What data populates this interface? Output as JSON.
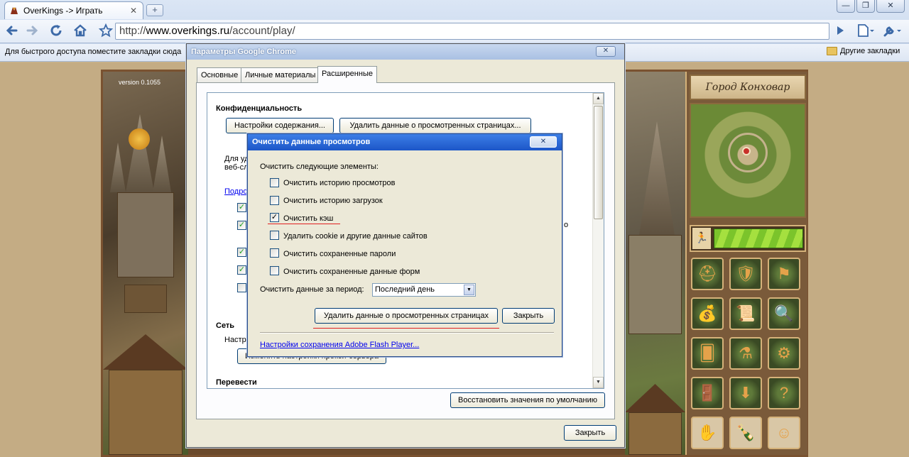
{
  "browser": {
    "tab_title": "OverKings -> Играть",
    "url_scheme": "http://",
    "url_host": "www.overkings.ru",
    "url_path": "/account/play/",
    "bookmarks_hint": "Для быстрого доступа поместите закладки сюда",
    "other_bookmarks": "Другие закладки",
    "window_controls": {
      "minimize": "—",
      "maximize": "❐",
      "close": "✕"
    }
  },
  "game": {
    "version": "version 0.1055",
    "city_name": "Город Конховар",
    "colors": {
      "energy": "#8fd234",
      "frame": "#7a5230"
    }
  },
  "options_dialog": {
    "title": "Параметры Google Chrome",
    "tabs": [
      "Основные",
      "Личные материалы",
      "Расширенные"
    ],
    "privacy_heading": "Конфиденциальность",
    "content_settings_btn": "Настройки содержания...",
    "clear_data_btn": "Удалить данные о просмотренных страницах...",
    "desc_line1": "Для уд",
    "desc_line2": "веб-сл",
    "desc_suffix": ".",
    "more_link": "Подро",
    "right_fragment": "о",
    "network_heading": "Сеть",
    "network_desc": "Настро",
    "proxy_btn": "Изменить настройки прокси-сервера",
    "translate_heading": "Перевести",
    "restore_btn": "Восстановить значения по умолчанию",
    "close_btn": "Закрыть"
  },
  "clear_dialog": {
    "title": "Очистить данные просмотров",
    "prompt": "Очистить следующие элементы:",
    "items": [
      {
        "label": "Очистить историю просмотров",
        "checked": false
      },
      {
        "label": "Очистить историю загрузок",
        "checked": false
      },
      {
        "label": "Очистить кэш",
        "checked": true
      },
      {
        "label": "Удалить cookie и другие данные сайтов",
        "checked": false
      },
      {
        "label": "Очистить сохраненные пароли",
        "checked": false
      },
      {
        "label": "Очистить сохраненные данные форм",
        "checked": false
      }
    ],
    "period_label": "Очистить данные за период:",
    "period_value": "Последний день",
    "clear_btn": "Удалить данные о просмотренных страницах",
    "close_btn": "Закрыть",
    "flash_link": "Настройки сохранения Adobe Flash Player..."
  }
}
